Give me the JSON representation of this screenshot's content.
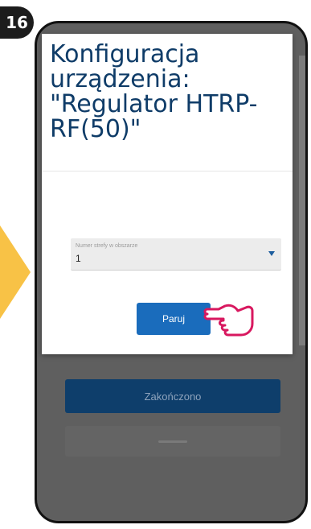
{
  "step": {
    "number": "16"
  },
  "dialog": {
    "title": "Konfiguracja urządzenia: \"Regulator HTRP-RF(50)\"",
    "select_label": "Numer strefy w obszarze",
    "select_value": "1",
    "pair_button_label": "Paruj"
  },
  "background": {
    "primary_button_label": "Zakończono"
  },
  "colors": {
    "accent": "#1a6cbc",
    "title": "#0f3c68",
    "badge": "#1c1c1c",
    "arrow": "#f8c246",
    "hand": "#d8185f"
  }
}
